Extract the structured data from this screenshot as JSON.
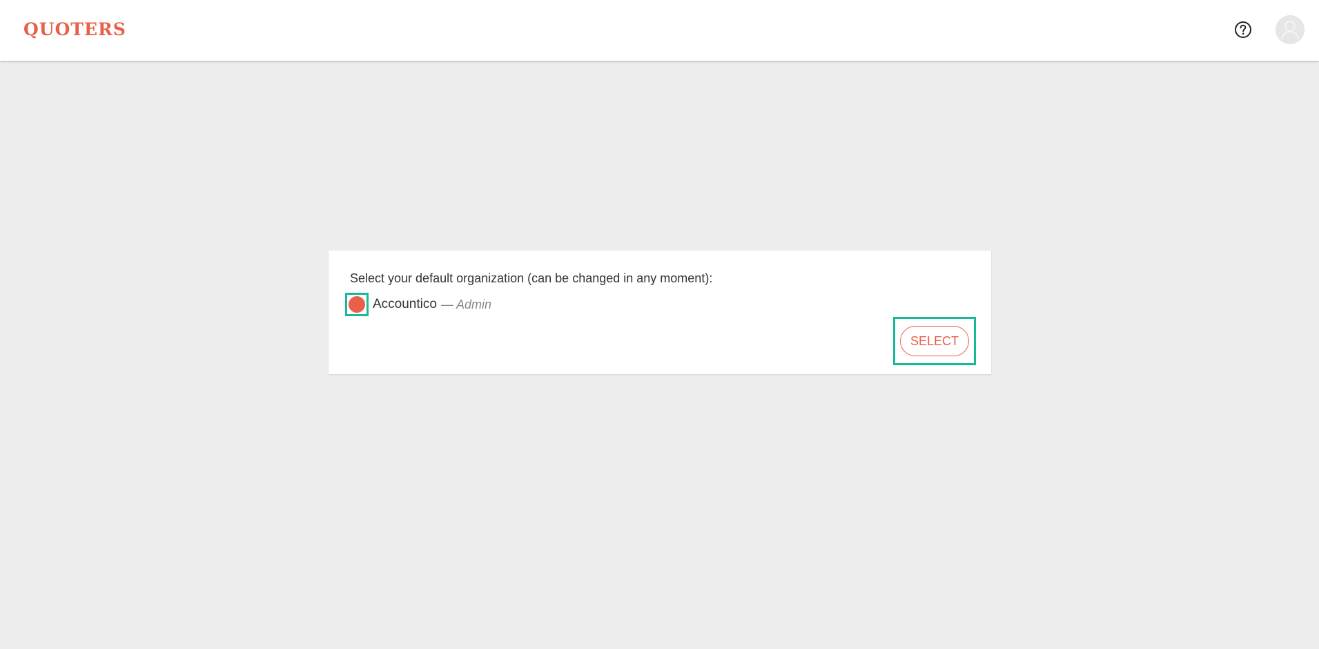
{
  "app": {
    "logo_text": "QUOTERS",
    "brand_color": "#e8604a",
    "highlight_color": "#17b997"
  },
  "header": {
    "help_icon": "help-circle-icon",
    "avatar_icon": "user-avatar-icon"
  },
  "org_dialog": {
    "prompt": "Select your default organization (can be changed in any moment):",
    "options": [
      {
        "name": "Accountico",
        "separator": "—",
        "role": "Admin",
        "selected": true
      }
    ],
    "select_label": "SELECT"
  }
}
